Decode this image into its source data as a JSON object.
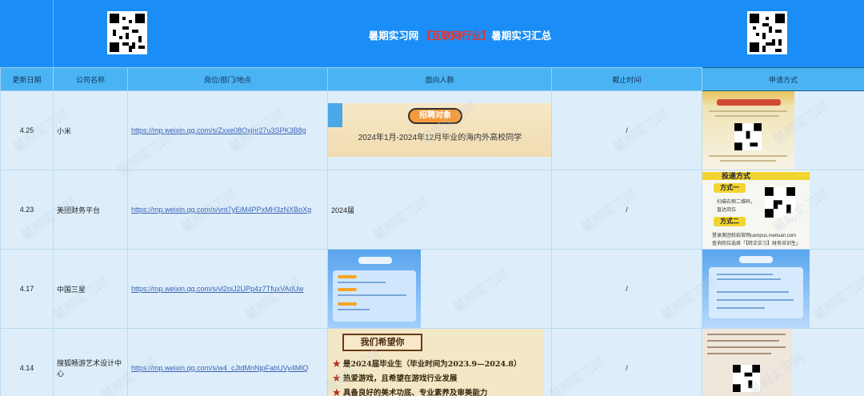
{
  "banner": {
    "title_prefix": "暑期实习网 ",
    "title_highlight": "【互联网行业】",
    "title_suffix": "暑期实习汇总"
  },
  "table": {
    "headers": [
      "更新日期",
      "公司名称",
      "岗位/部门/地点",
      "面向人群",
      "截止时间",
      "申请方式"
    ],
    "rows": [
      {
        "date": "4.25",
        "company": "小米",
        "link": "https://mp.weixin.qq.com/s/Zxxe08Oxjnr27u3SPK3B8g",
        "audience_text": "",
        "deadline": "/",
        "poster_badge": "招聘对象",
        "poster_text": "2024年1月-2024年12月毕业的海内外高校同学"
      },
      {
        "date": "4.23",
        "company": "美团财务平台",
        "link": "https://mp.weixin.qq.com/s/vnt7yEiM4PPxMH3zNXBoXg",
        "audience_text": "2024届",
        "deadline": "/",
        "apply_title": "投递方式",
        "apply_way1": "方式一",
        "apply_way1_text1": "扫描右侧二维码，",
        "apply_way1_text2": "直达岗位",
        "apply_way2": "方式二",
        "apply_foot1": "登录美团校招官网campus.meituan.com",
        "apply_foot2": "查询岗位选择「【转正实习】财务培训生」"
      },
      {
        "date": "4.17",
        "company": "中国三星",
        "link": "https://mp.weixin.qq.com/s/vl2oiJ2UPp4z7TfuxVAdUw",
        "audience_text": "",
        "deadline": "/"
      },
      {
        "date": "4.14",
        "company": "搜狐畅游艺术设计中心",
        "link": "https://mp.weixin.qq.com/s/w4_cJtdMnNjpFabUVy4MlQ",
        "audience_text": "",
        "deadline": "/",
        "poster_head": "我们希望你",
        "poster_lines": [
          "是2024届毕业生（毕业时间为2023.9—2024.8）",
          "热爱游戏，且希望在游戏行业发展",
          "具备良好的美术功底、专业素养及审美能力"
        ],
        "star_glyph": "★"
      }
    ]
  },
  "watermark": "暑期实习网",
  "colors": {
    "banner": "#1a8ef6",
    "header": "#4ab3f4",
    "cell": "#ddeefa",
    "highlight": "#e8332a",
    "link": "#3b62b4"
  }
}
